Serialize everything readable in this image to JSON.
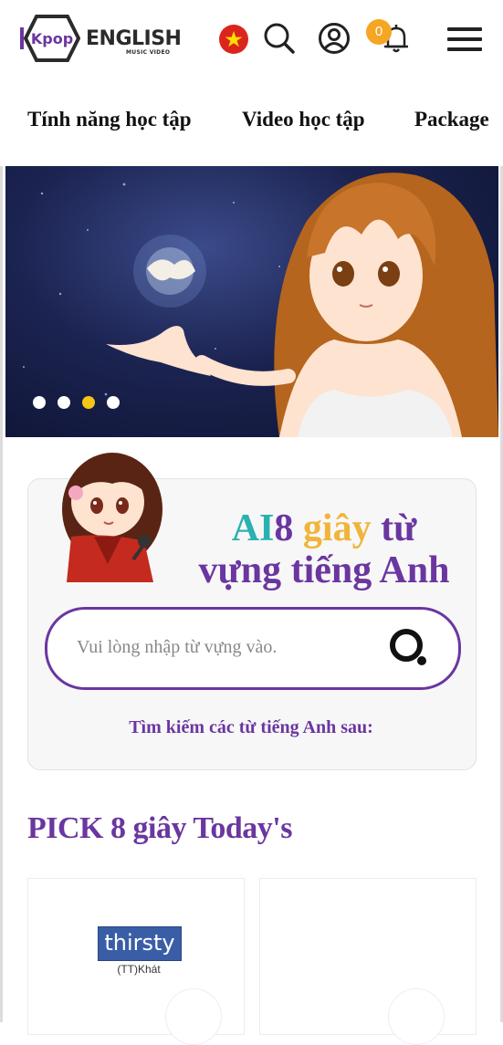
{
  "header": {
    "logo_text": "ENGLISH",
    "logo_sub": "MUSIC VIDEO",
    "logo_mark_text": "Kpop",
    "notification_count": "0",
    "colors": {
      "flag": "#da251d",
      "badge": "#f5a623"
    }
  },
  "nav": {
    "items": [
      {
        "label": "Tính năng học tập"
      },
      {
        "label": "Video học tập"
      },
      {
        "label": "Package"
      }
    ]
  },
  "banner": {
    "slides_count": 4,
    "active_slide": 3
  },
  "search": {
    "title_ai": "AI",
    "title_8": "8",
    "title_giay": "giây",
    "title_rest1": "từ",
    "title_line2": "vựng tiếng Anh",
    "placeholder": "Vui lòng nhập từ vựng vào.",
    "hint": "Tìm kiếm các từ tiếng Anh sau:",
    "colors": {
      "teal": "#2ab1b1",
      "purple": "#6b36a0",
      "gold": "#f0b43a"
    }
  },
  "pick": {
    "title": "PICK 8 giây Today's",
    "cards": [
      {
        "word": "thirsty",
        "meaning": "(TT)Khát"
      },
      {
        "word": "",
        "meaning": ""
      }
    ]
  }
}
